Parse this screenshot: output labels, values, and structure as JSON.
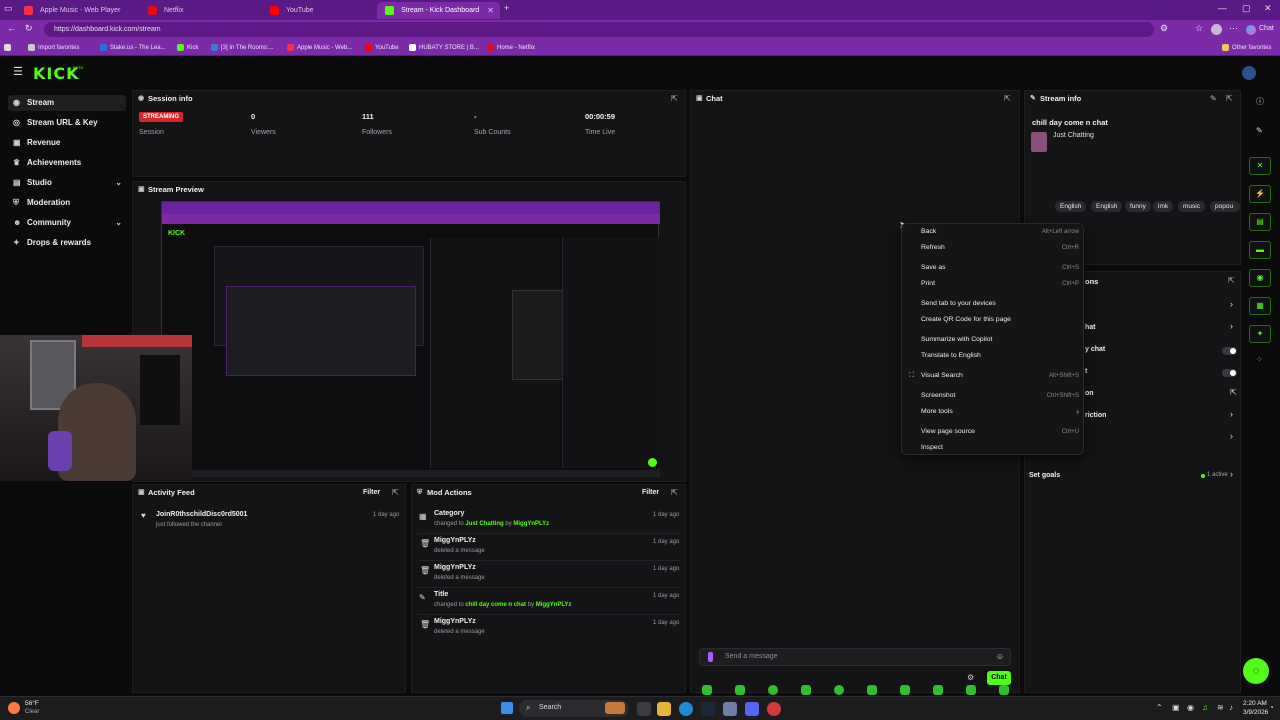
{
  "browser": {
    "tabs": [
      {
        "title": "Apple Music - Web Player",
        "color": "#fa2d48",
        "active": false
      },
      {
        "title": "Netflix",
        "color": "#e50914",
        "active": false
      },
      {
        "title": "YouTube",
        "color": "#ff0000",
        "active": false
      },
      {
        "title": "Stream - Kick Dashboard",
        "color": "#53fc18",
        "active": true
      }
    ],
    "new_tab": "+",
    "url": "https://dashboard.kick.com/stream",
    "copilot_label": "Chat",
    "bookmarks": [
      {
        "label": "Import favorites",
        "color": "#cccccc"
      },
      {
        "label": "Stake.us - The Lea...",
        "color": "#2a6fdb"
      },
      {
        "label": "Kick",
        "color": "#53fc18"
      },
      {
        "label": "[3] In The Rooms:...",
        "color": "#3a7bd5"
      },
      {
        "label": "Apple Music - Web...",
        "color": "#fa2d48"
      },
      {
        "label": "YouTube",
        "color": "#ff0000"
      },
      {
        "label": "HUBATY STORE | B...",
        "color": "#ffffff"
      },
      {
        "label": "Home - Netflix",
        "color": "#e50914"
      }
    ],
    "other_favorites": "Other favorites"
  },
  "app": {
    "logo": "KICK",
    "beta": "BETA",
    "sidebar": [
      {
        "label": "Stream",
        "icon": "broadcast-icon",
        "glyph": "((·))",
        "active": true,
        "chevron": false
      },
      {
        "label": "Stream URL & Key",
        "icon": "globe-icon",
        "glyph": "◎",
        "active": false,
        "chevron": false
      },
      {
        "label": "Revenue",
        "icon": "revenue-icon",
        "glyph": "▣",
        "active": false,
        "chevron": false
      },
      {
        "label": "Achievements",
        "icon": "trophy-icon",
        "glyph": "♛",
        "active": false,
        "chevron": false
      },
      {
        "label": "Studio",
        "icon": "studio-icon",
        "glyph": "▤",
        "active": false,
        "chevron": true
      },
      {
        "label": "Moderation",
        "icon": "shield-icon",
        "glyph": "⛨",
        "active": false,
        "chevron": false
      },
      {
        "label": "Community",
        "icon": "users-icon",
        "glyph": "☻",
        "active": false,
        "chevron": true
      },
      {
        "label": "Drops & rewards",
        "icon": "gift-icon",
        "glyph": "✦",
        "active": false,
        "chevron": false
      }
    ],
    "session": {
      "title": "Session info",
      "status": "STREAMING",
      "status_label": "Session",
      "stats": [
        {
          "value": "0",
          "label": "Viewers"
        },
        {
          "value": "111",
          "label": "Followers"
        },
        {
          "value": "-",
          "label": "Sub Counts"
        },
        {
          "value": "00:00:59",
          "label": "Time Live"
        }
      ]
    },
    "preview": {
      "title": "Stream Preview"
    },
    "activity": {
      "title": "Activity Feed",
      "filter": "Filter",
      "items": [
        {
          "name": "JoinR0thschildDisc0rd5001",
          "sub": "just followed the channel",
          "time": "1 day ago"
        }
      ]
    },
    "mod_actions": {
      "title": "Mod Actions",
      "filter": "Filter",
      "items": [
        {
          "name": "Category",
          "pre": "changed to ",
          "hl1": "Just Chatting",
          "mid": " by ",
          "hl2": "MiggYnPLYz",
          "time": "1 day ago",
          "icon": "calendar-icon",
          "glyph": "▦"
        },
        {
          "name": "MiggYnPLYz",
          "pre": "deleted a message",
          "hl1": "",
          "mid": "",
          "hl2": "",
          "time": "1 day ago",
          "icon": "trash-icon",
          "glyph": "🗑"
        },
        {
          "name": "MiggYnPLYz",
          "pre": "deleted a message",
          "hl1": "",
          "mid": "",
          "hl2": "",
          "time": "1 day ago",
          "icon": "trash-icon",
          "glyph": "🗑"
        },
        {
          "name": "Title",
          "pre": "changed to ",
          "hl1": "chill day come n chat",
          "mid": " by ",
          "hl2": "MiggYnPLYz",
          "time": "1 day ago",
          "icon": "title-edit-icon",
          "glyph": "✎"
        },
        {
          "name": "MiggYnPLYz",
          "pre": "deleted a message",
          "hl1": "",
          "mid": "",
          "hl2": "",
          "time": "1 day ago",
          "icon": "trash-icon",
          "glyph": "🗑"
        }
      ]
    },
    "chat": {
      "title": "Chat",
      "placeholder": "Send a message",
      "send_label": "Chat"
    },
    "stream_info": {
      "title": "Stream info",
      "stream_title": "chill day come n chat",
      "category": "Just Chatting",
      "tags": [
        "English",
        "English",
        "funny",
        "lmk",
        "music",
        "popou"
      ]
    },
    "quick_actions": {
      "section_suffix": "ons",
      "rows": [
        {
          "text": "hat"
        },
        {
          "text": "y chat"
        },
        {
          "text": "t"
        },
        {
          "text": "on"
        },
        {
          "text": "riction"
        }
      ],
      "goals_label": "Set goals",
      "goals_status": "1 active"
    }
  },
  "context_menu": [
    {
      "label": "Back",
      "shortcut": "Alt+Left arrow",
      "icon": ""
    },
    {
      "label": "Refresh",
      "shortcut": "Ctrl+R",
      "icon": ""
    },
    {
      "label": "Save as",
      "shortcut": "Ctrl+S",
      "icon": ""
    },
    {
      "label": "Print",
      "shortcut": "Ctrl+P",
      "icon": ""
    },
    {
      "label": "Send tab to your devices",
      "shortcut": "",
      "icon": ""
    },
    {
      "label": "Create QR Code for this page",
      "shortcut": "",
      "icon": ""
    },
    {
      "label": "Summarize with Copilot",
      "shortcut": "",
      "icon": ""
    },
    {
      "label": "Translate to English",
      "shortcut": "",
      "icon": ""
    },
    {
      "label": "Visual Search",
      "shortcut": "Alt+Shift+S",
      "icon": "⛶"
    },
    {
      "label": "Screenshot",
      "shortcut": "Ctrl+Shift+S",
      "icon": ""
    },
    {
      "label": "More tools",
      "shortcut": "›",
      "icon": ""
    },
    {
      "label": "View page source",
      "shortcut": "Ctrl+U",
      "icon": ""
    },
    {
      "label": "Inspect",
      "shortcut": "",
      "icon": ""
    }
  ],
  "taskbar": {
    "weather_temp": "56°F",
    "weather_cond": "Clear",
    "search_label": "Search",
    "time": "2:20 AM",
    "date": "3/9/2026"
  }
}
